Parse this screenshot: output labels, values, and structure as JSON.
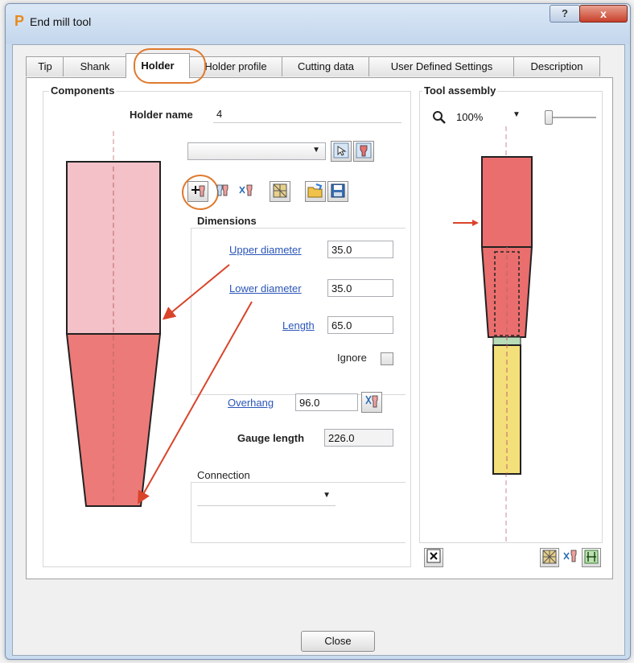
{
  "window": {
    "title": "End mill tool",
    "help_label": "?",
    "close_label": "x"
  },
  "tabs": [
    {
      "label": "Tip"
    },
    {
      "label": "Shank"
    },
    {
      "label": "Holder"
    },
    {
      "label": "Holder profile"
    },
    {
      "label": "Cutting data"
    },
    {
      "label": "User Defined Settings"
    },
    {
      "label": "Description"
    }
  ],
  "active_tab": "Holder",
  "components": {
    "title": "Components",
    "holder_name_label": "Holder name",
    "holder_name_value": "4",
    "dimensions_title": "Dimensions",
    "upper_diameter_label": "Upper diameter",
    "upper_diameter_value": "35.0",
    "lower_diameter_label": "Lower diameter",
    "lower_diameter_value": "35.0",
    "length_label": "Length",
    "length_value": "65.0",
    "ignore_label": "Ignore",
    "overhang_label": "Overhang",
    "overhang_value": "96.0",
    "gauge_length_label": "Gauge length",
    "gauge_length_value": "226.0",
    "connection_title": "Connection",
    "connection_value": ""
  },
  "tool_assembly": {
    "title": "Tool assembly",
    "zoom": "100%"
  },
  "footer": {
    "close_label": "Close"
  },
  "colors": {
    "holder_upper": "#f4c1c8",
    "holder_lower": "#ec7a78",
    "assembly_red": "#ea6e6e",
    "assembly_yellow": "#f4e07a",
    "assembly_green": "#b8dcb8",
    "highlight_ring": "#e07a2e",
    "arrow": "#d9442a"
  },
  "icons": [
    "app-p-icon",
    "pick-icon",
    "holder-icon",
    "add-holder-icon",
    "copy-holder-icon",
    "holder-edit-icon",
    "grid-icon",
    "open-folder-icon",
    "save-icon",
    "magnifier-icon",
    "fit-view-icon"
  ]
}
